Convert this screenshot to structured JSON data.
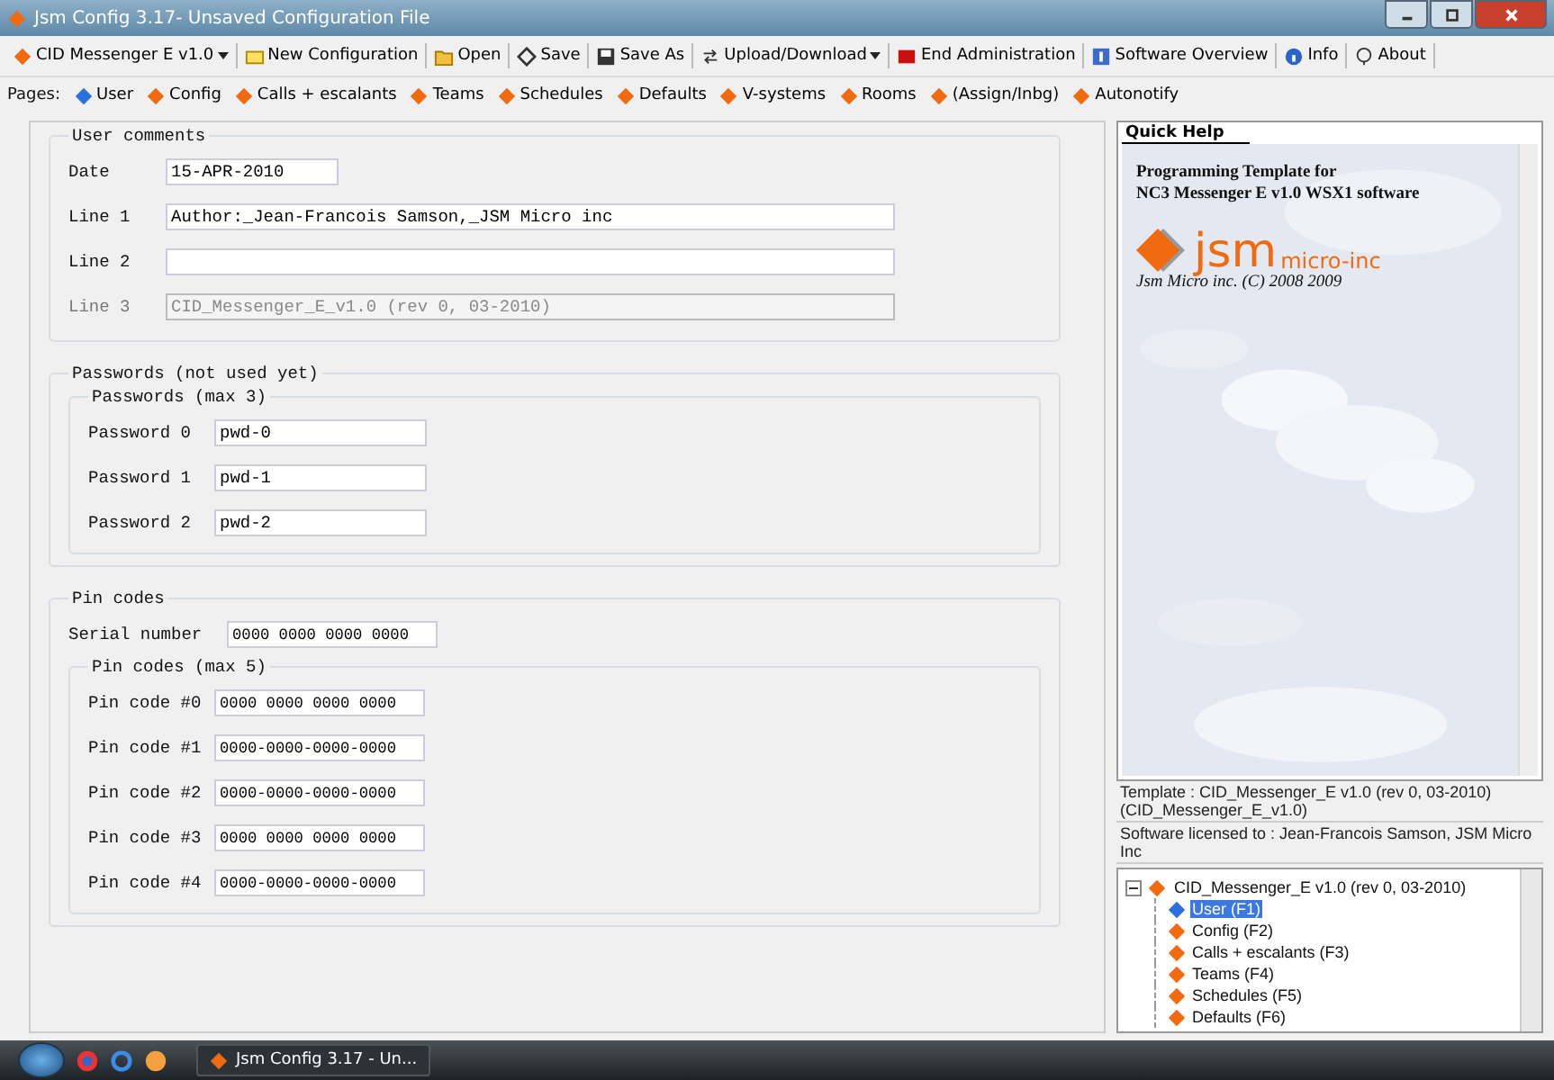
{
  "window": {
    "title": "Jsm Config 3.17- Unsaved Configuration File"
  },
  "toolbar": [
    {
      "label": "CID Messenger E v1.0",
      "kind": "dropdown"
    },
    {
      "label": "New Configuration",
      "kind": "button"
    },
    {
      "label": "Open",
      "kind": "button"
    },
    {
      "label": "Save",
      "kind": "button"
    },
    {
      "label": "Save As",
      "kind": "button"
    },
    {
      "label": "Upload/Download",
      "kind": "dropdown"
    },
    {
      "label": "End Administration",
      "kind": "button"
    },
    {
      "label": "Software Overview",
      "kind": "button"
    },
    {
      "label": "Info",
      "kind": "button"
    },
    {
      "label": "About",
      "kind": "button"
    }
  ],
  "pages": {
    "label": "Pages:",
    "items": [
      {
        "label": "User",
        "selected": true
      },
      {
        "label": "Config",
        "selected": false
      },
      {
        "label": "Calls + escalants",
        "selected": false
      },
      {
        "label": "Teams",
        "selected": false
      },
      {
        "label": "Schedules",
        "selected": false
      },
      {
        "label": "Defaults",
        "selected": false
      },
      {
        "label": "V-systems",
        "selected": false
      },
      {
        "label": "Rooms",
        "selected": false
      },
      {
        "label": "(Assign/Inbg)",
        "selected": false
      },
      {
        "label": "Autonotify",
        "selected": false
      }
    ]
  },
  "user_comments": {
    "title": "User comments",
    "fields": [
      {
        "label": "Date",
        "value": "15-APR-2010",
        "kind": "short",
        "disabled": false
      },
      {
        "label": "Line 1",
        "value": "Author:_Jean-Francois Samson,_JSM Micro inc",
        "kind": "long",
        "disabled": false
      },
      {
        "label": "Line 2",
        "kind": "long",
        "disabled": false
      },
      {
        "label": "Line 3",
        "value": "CID_Messenger_E_v1.0 (rev 0, 03-2010)",
        "kind": "long",
        "disabled": true
      }
    ]
  },
  "passwords": {
    "title": "Passwords (not used yet)",
    "group": "Passwords (max 3)",
    "fields": [
      {
        "label": "Password 0",
        "value": "pwd-0"
      },
      {
        "label": "Password 1",
        "value": "pwd-1"
      },
      {
        "label": "Password 2",
        "value": "pwd-2"
      }
    ]
  },
  "pin_codes": {
    "title": "Pin codes",
    "serial": {
      "label": "Serial number",
      "value": "0000 0000 0000 0000"
    },
    "group": "Pin codes (max 5)",
    "fields": [
      {
        "label": "Pin code #0",
        "value": "0000 0000 0000 0000"
      },
      {
        "label": "Pin code #1",
        "value": "0000-0000-0000-0000"
      },
      {
        "label": "Pin code #2",
        "value": "0000-0000-0000-0000"
      },
      {
        "label": "Pin code #3",
        "value": "0000 0000 0000 0000"
      },
      {
        "label": "Pin code #4",
        "value": "0000-0000-0000-0000"
      }
    ]
  },
  "quick_help": {
    "tab": "Quick Help",
    "heading": [
      "Programming Template for",
      "NC3  Messenger  E  v1.0 WSX1 software"
    ],
    "logo_main": "jsm",
    "logo_sub": "micro-inc",
    "copyright": "Jsm Micro inc. (C) 2008 2009"
  },
  "info": [
    "Template : CID_Messenger_E v1.0 (rev 0, 03-2010) (CID_Messenger_E_v1.0)",
    "Software licensed to : Jean-Francois Samson, JSM Micro Inc"
  ],
  "tree": {
    "label": "CID_Messenger_E v1.0 (rev 0, 03-2010)",
    "expanded": true,
    "children": [
      {
        "label": "User (F1)",
        "selected": true
      },
      {
        "label": "Config (F2)",
        "selected": false
      },
      {
        "label": "Calls + escalants (F3)",
        "selected": false
      },
      {
        "label": "Teams (F4)",
        "selected": false
      },
      {
        "label": "Schedules (F5)",
        "selected": false
      },
      {
        "label": "Defaults (F6)",
        "selected": false
      }
    ]
  },
  "taskbar": {
    "task": "Jsm Config 3.17 - Un..."
  }
}
